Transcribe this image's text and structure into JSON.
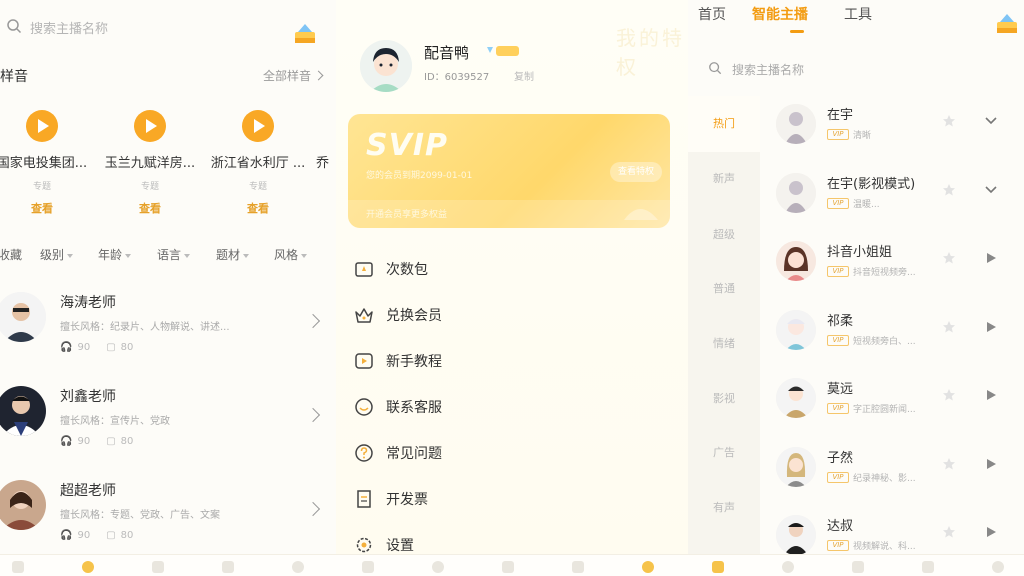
{
  "left": {
    "search_placeholder": "搜索主播名称",
    "section_title": "样音",
    "section_more": "全部样音",
    "samples": [
      {
        "name": "国家电投集团...",
        "tag": "专题",
        "button": "查看"
      },
      {
        "name": "玉兰九赋洋房...",
        "tag": "专题",
        "button": "查看"
      },
      {
        "name": "浙江省水利厅 ...",
        "tag": "专题",
        "button": "查看"
      },
      {
        "name": "乔",
        "tag": "",
        "button": ""
      }
    ],
    "filters": [
      "收藏",
      "级别",
      "年龄",
      "语言",
      "题材",
      "风格"
    ],
    "teachers": [
      {
        "name": "海涛老师",
        "desc": "擅长风格：纪录片、人物解说、讲述...",
        "plays": "90",
        "count": "80"
      },
      {
        "name": "刘鑫老师",
        "desc": "擅长风格：宣传片、党政",
        "plays": "90",
        "count": "80"
      },
      {
        "name": "超超老师",
        "desc": "擅长风格：专题、党政、广告、文案",
        "plays": "90",
        "count": "80"
      }
    ]
  },
  "middle": {
    "profile_name": "配音鸭",
    "profile_id": "ID：6039527",
    "copy_label": "复制",
    "faint_watermark": "我的特权",
    "svip": {
      "title": "SVIP",
      "expire": "您的会员到期2099-01-01",
      "button": "查看特权",
      "bottom_text": "开通会员享更多权益"
    },
    "menu": [
      {
        "label": "次数包",
        "icon": "ticket-icon"
      },
      {
        "label": "兑换会员",
        "icon": "crown-icon"
      },
      {
        "label": "新手教程",
        "icon": "video-icon"
      },
      {
        "label": "联系客服",
        "icon": "smile-icon"
      },
      {
        "label": "常见问题",
        "icon": "question-icon"
      },
      {
        "label": "开发票",
        "icon": "invoice-icon"
      },
      {
        "label": "设置",
        "icon": "gear-icon"
      }
    ]
  },
  "right": {
    "tabs": [
      "首页",
      "智能主播",
      "工具"
    ],
    "active_tab": "智能主播",
    "search_placeholder": "搜索主播名称",
    "categories": [
      "热门",
      "新声",
      "超级",
      "普通",
      "情绪",
      "影视",
      "广告",
      "有声"
    ],
    "voices": [
      {
        "name": "在宇",
        "badge": "VIP",
        "tag": "清晰",
        "action": "expand"
      },
      {
        "name": "在宇(影视模式)",
        "badge": "VIP",
        "tag": "温暖...",
        "action": "expand"
      },
      {
        "name": "抖音小姐姐",
        "badge": "VIP",
        "tag": "抖音短视频旁...",
        "action": "play"
      },
      {
        "name": "祁柔",
        "badge": "VIP",
        "tag": "短视频旁白、...",
        "action": "play"
      },
      {
        "name": "莫远",
        "badge": "VIP",
        "tag": "字正腔圆新闻...",
        "action": "play"
      },
      {
        "name": "子然",
        "badge": "VIP",
        "tag": "纪录神秘、影...",
        "action": "play"
      },
      {
        "name": "达叔",
        "badge": "VIP",
        "tag": "视频解说、科...",
        "action": "play"
      }
    ]
  },
  "colors": {
    "accent": "#f39c12",
    "play": "#f9a825",
    "svip_gold": "#ffd86b"
  }
}
